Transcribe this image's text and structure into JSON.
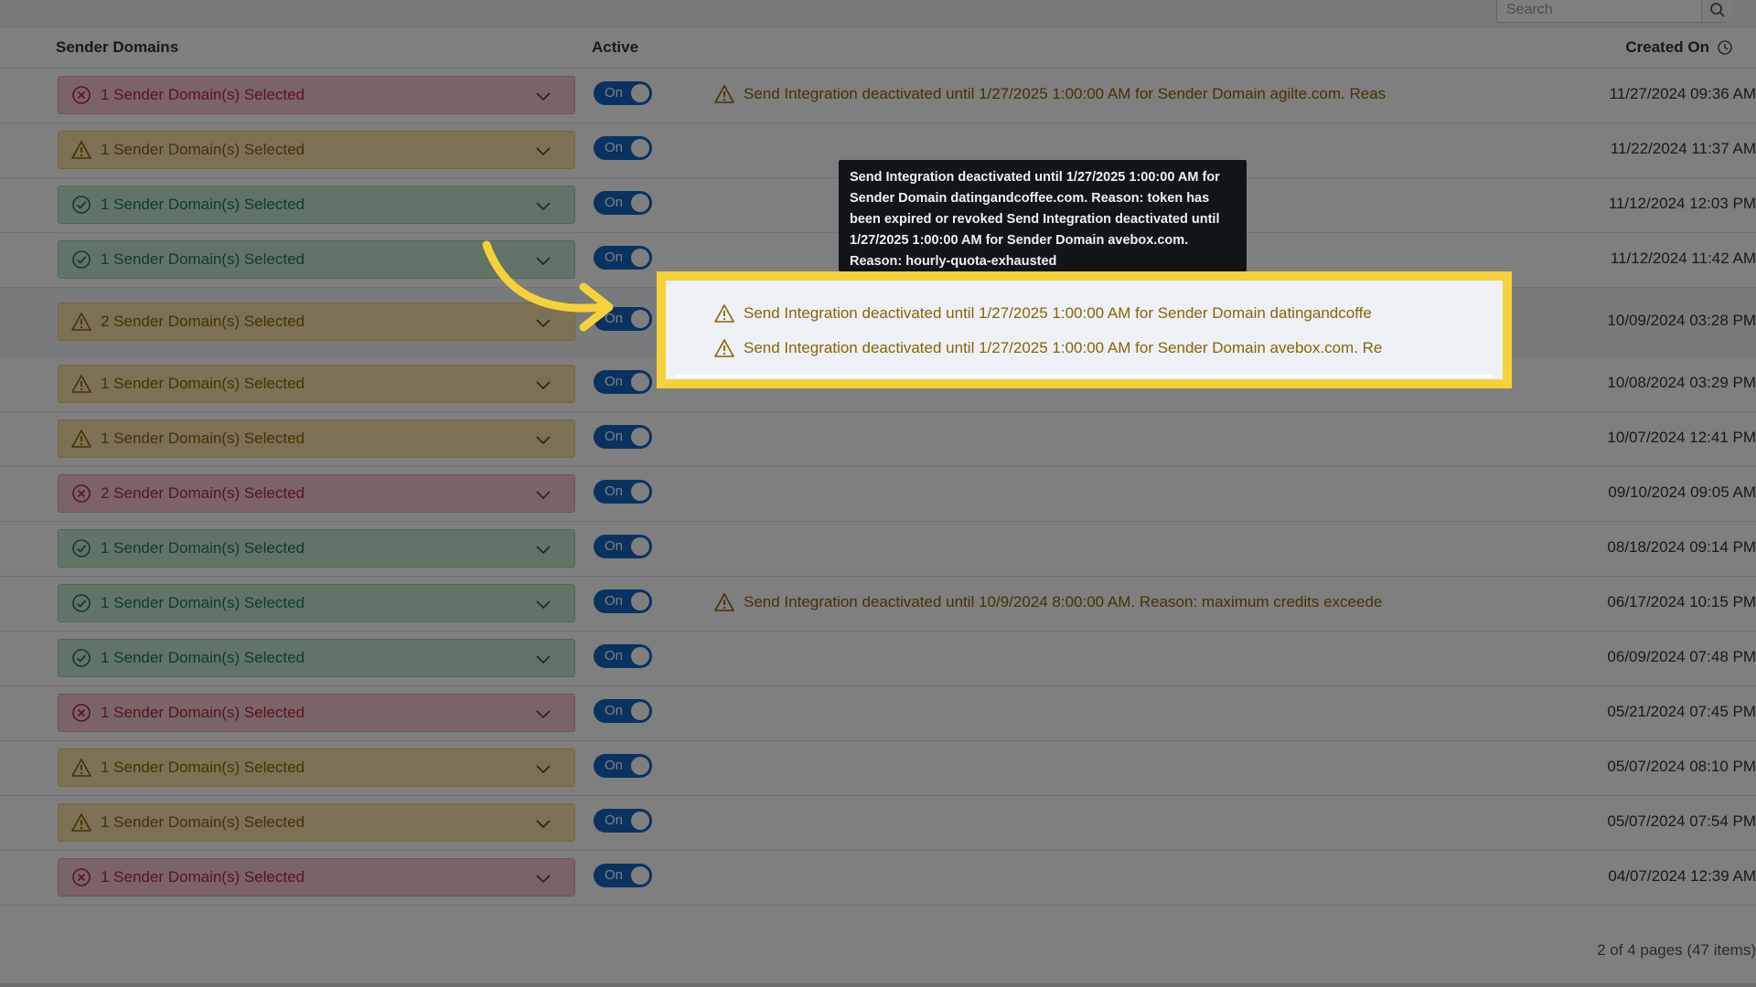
{
  "search": {
    "placeholder": "Search"
  },
  "header": {
    "sender_domains": "Sender Domains",
    "active": "Active",
    "created_on": "Created On"
  },
  "colors": {
    "error_bg": "#f6c8cd",
    "warning_bg": "#f8e2a9",
    "success_bg": "#c4e8d1",
    "toggle": "#1565c0",
    "highlight": "#f6d23a",
    "arrow": "#f6d23a"
  },
  "icons": {
    "error": "x-circle-icon",
    "warning": "warning-triangle-icon",
    "success": "check-circle-icon",
    "chevron": "chevron-down-icon",
    "search": "search-icon",
    "sort": "clock-icon"
  },
  "rows": [
    {
      "status": "error",
      "label": "1 Sender Domain(s) Selected",
      "toggle": "On",
      "message": "Send Integration deactivated until 1/27/2025 1:00:00 AM for Sender Domain agilte.com. Reas",
      "created": "11/27/2024 09:36 AM"
    },
    {
      "status": "warning",
      "label": "1 Sender Domain(s) Selected",
      "toggle": "On",
      "message": "",
      "created": "11/22/2024 11:37 AM"
    },
    {
      "status": "success",
      "label": "1 Sender Domain(s) Selected",
      "toggle": "On",
      "message": "",
      "created": "11/12/2024 12:03 PM"
    },
    {
      "status": "success",
      "label": "1 Sender Domain(s) Selected",
      "toggle": "On",
      "message": "",
      "created": "11/12/2024 11:42 AM"
    },
    {
      "status": "warning",
      "label": "2 Sender Domain(s) Selected",
      "toggle": "On",
      "message": "",
      "created": "10/09/2024 03:28 PM"
    },
    {
      "status": "warning",
      "label": "1 Sender Domain(s) Selected",
      "toggle": "On",
      "message": "",
      "created": "10/08/2024 03:29 PM"
    },
    {
      "status": "warning",
      "label": "1 Sender Domain(s) Selected",
      "toggle": "On",
      "message": "",
      "created": "10/07/2024 12:41 PM"
    },
    {
      "status": "error",
      "label": "2 Sender Domain(s) Selected",
      "toggle": "On",
      "message": "",
      "created": "09/10/2024 09:05 AM"
    },
    {
      "status": "success",
      "label": "1 Sender Domain(s) Selected",
      "toggle": "On",
      "message": "",
      "created": "08/18/2024 09:14 PM"
    },
    {
      "status": "success",
      "label": "1 Sender Domain(s) Selected",
      "toggle": "On",
      "message": "Send Integration deactivated until 10/9/2024 8:00:00 AM. Reason: maximum credits exceede",
      "created": "06/17/2024 10:15 PM"
    },
    {
      "status": "success",
      "label": "1 Sender Domain(s) Selected",
      "toggle": "On",
      "message": "",
      "created": "06/09/2024 07:48 PM"
    },
    {
      "status": "error",
      "label": "1 Sender Domain(s) Selected",
      "toggle": "On",
      "message": "",
      "created": "05/21/2024 07:45 PM"
    },
    {
      "status": "warning",
      "label": "1 Sender Domain(s) Selected",
      "toggle": "On",
      "message": "",
      "created": "05/07/2024 08:10 PM"
    },
    {
      "status": "warning",
      "label": "1 Sender Domain(s) Selected",
      "toggle": "On",
      "message": "",
      "created": "05/07/2024 07:54 PM"
    },
    {
      "status": "error",
      "label": "1 Sender Domain(s) Selected",
      "toggle": "On",
      "message": "",
      "created": "04/07/2024 12:39 AM"
    }
  ],
  "highlight_messages": [
    "Send Integration deactivated until 1/27/2025 1:00:00 AM for Sender Domain datingandcoffe",
    "Send Integration deactivated until 1/27/2025 1:00:00 AM for Sender Domain avebox.com. Re"
  ],
  "tooltip": {
    "lines": [
      "Send Integration deactivated until 1/27/2025 1:00:00 AM for",
      "Sender Domain datingandcoffee.com. Reason: token has",
      "been expired or revoked Send Integration deactivated until",
      "1/27/2025 1:00:00 AM for Sender Domain avebox.com.",
      "Reason: hourly-quota-exhausted"
    ]
  },
  "pagination": {
    "text": "2 of 4 pages (47 items)"
  }
}
